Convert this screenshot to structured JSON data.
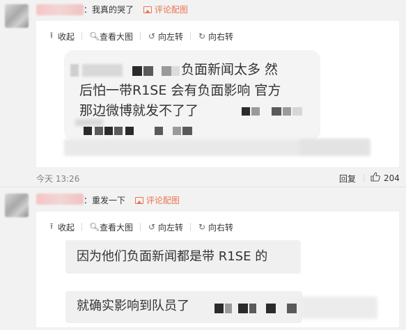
{
  "comment1": {
    "text": "：我真的哭了",
    "pic_link": "评论配图",
    "toolbar": {
      "collapse": "收起",
      "view_large": "查看大图",
      "rotate_left": "向左转",
      "rotate_right": "向右转"
    },
    "image_lines": [
      "负面新闻太多 然",
      "后怕一带R1SE 会有负面影响 官方",
      "那边微博就发不了了"
    ],
    "time": "今天 13:26",
    "reply": "回复",
    "likes": "204"
  },
  "comment2": {
    "text": "：重发一下",
    "pic_link": "评论配图",
    "toolbar": {
      "collapse": "收起",
      "view_large": "查看大图",
      "rotate_left": "向左转",
      "rotate_right": "向右转"
    },
    "image_lines": [
      "因为他们负面新闻都是带 R1SE 的",
      "就确实影响到队员了"
    ]
  },
  "icons": [
    "collapse-arrow-icon",
    "magnifier-icon",
    "rotate-left-icon",
    "rotate-right-icon",
    "picture-icon",
    "thumbs-up-icon"
  ],
  "colors": {
    "link": "#eb7350",
    "background": "#f2f2f2",
    "card": "#ffffff"
  }
}
